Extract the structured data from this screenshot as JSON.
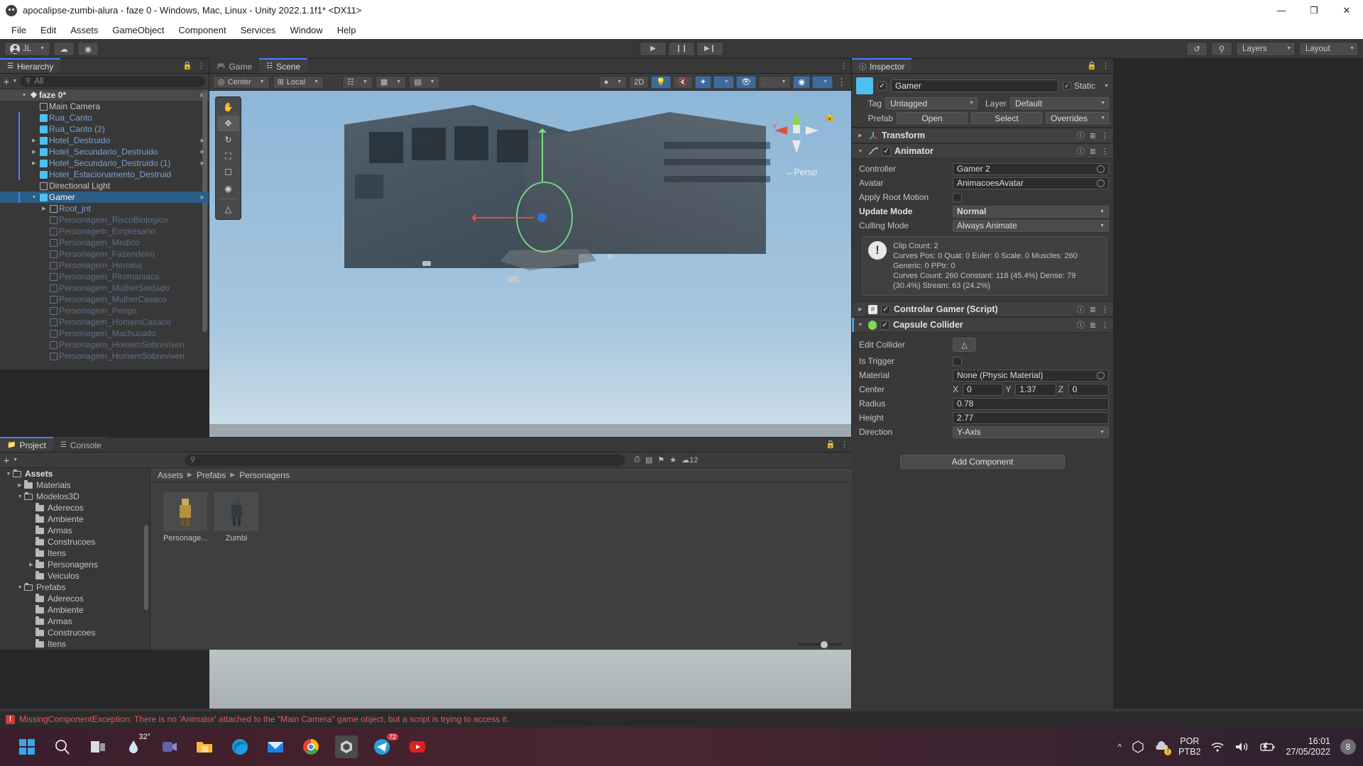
{
  "window": {
    "title": "apocalipse-zumbi-alura - faze 0 - Windows, Mac, Linux - Unity 2022.1.1f1* <DX11>",
    "minimize": "—",
    "maximize": "❐",
    "close": "✕"
  },
  "menubar": [
    "File",
    "Edit",
    "Assets",
    "GameObject",
    "Component",
    "Services",
    "Window",
    "Help"
  ],
  "toolbar": {
    "account": "JL",
    "play": "▶",
    "pause": "❙❙",
    "step": "▶❙",
    "layers": "Layers",
    "layout": "Layout"
  },
  "hierarchy": {
    "tab": "Hierarchy",
    "search_placeholder": "All",
    "scene": "faze 0*",
    "items": [
      {
        "label": "Main Camera",
        "depth": 2,
        "type": "go",
        "expand": "none"
      },
      {
        "label": "Rua_Canto",
        "depth": 2,
        "type": "prefab",
        "expand": "none"
      },
      {
        "label": "Rua_Canto (2)",
        "depth": 2,
        "type": "prefab",
        "expand": "none"
      },
      {
        "label": "Hotel_Destruido",
        "depth": 2,
        "type": "prefab",
        "expand": "collapsed",
        "arrow": true
      },
      {
        "label": "Hotel_Secundario_Destruido",
        "depth": 2,
        "type": "prefab",
        "expand": "collapsed",
        "arrow": true
      },
      {
        "label": "Hotel_Secundario_Destruido (1)",
        "depth": 2,
        "type": "prefab",
        "expand": "collapsed",
        "arrow": true
      },
      {
        "label": "Hotel_Estacionamento_Destruid",
        "depth": 2,
        "type": "prefab",
        "expand": "none"
      },
      {
        "label": "Directional Light",
        "depth": 2,
        "type": "go",
        "expand": "none"
      },
      {
        "label": "Gamer",
        "depth": 2,
        "type": "prefab",
        "expand": "expanded",
        "selected": true,
        "arrow": true
      },
      {
        "label": "Root_jnt",
        "depth": 3,
        "type": "go-blue",
        "expand": "collapsed"
      },
      {
        "label": "Personagem_RiscoBiologico",
        "depth": 3,
        "type": "dim",
        "expand": "none"
      },
      {
        "label": "Personagem_Empresario",
        "depth": 3,
        "type": "dim",
        "expand": "none"
      },
      {
        "label": "Personagem_Medico",
        "depth": 3,
        "type": "dim",
        "expand": "none"
      },
      {
        "label": "Personagem_Fazendeiro",
        "depth": 3,
        "type": "dim",
        "expand": "none"
      },
      {
        "label": "Personagem_Heroina",
        "depth": 3,
        "type": "dim",
        "expand": "none"
      },
      {
        "label": "Personagem_Piromaniaca",
        "depth": 3,
        "type": "dim",
        "expand": "none"
      },
      {
        "label": "Personagem_MulherSoldado",
        "depth": 3,
        "type": "dim",
        "expand": "none"
      },
      {
        "label": "Personagem_MulherCasaco",
        "depth": 3,
        "type": "dim",
        "expand": "none"
      },
      {
        "label": "Personagem_Perigo",
        "depth": 3,
        "type": "dim",
        "expand": "none"
      },
      {
        "label": "Personagem_HomemCasaco",
        "depth": 3,
        "type": "dim",
        "expand": "none"
      },
      {
        "label": "Personagem_Machucado",
        "depth": 3,
        "type": "dim",
        "expand": "none"
      },
      {
        "label": "Personagem_HomemSobreviven",
        "depth": 3,
        "type": "dim",
        "expand": "none"
      },
      {
        "label": "Personagem_HomemSobreviven",
        "depth": 3,
        "type": "dim",
        "expand": "none"
      }
    ]
  },
  "scene_view": {
    "tabs": [
      {
        "label": "Game",
        "icon": "gamepad-icon",
        "active": false
      },
      {
        "label": "Scene",
        "icon": "scene-icon",
        "active": true
      }
    ],
    "pivot": "Center",
    "space": "Local",
    "persp_label": "←Persp",
    "axis_x": "x",
    "axis_y": "y",
    "tools": [
      "hand-tool",
      "move-tool",
      "rotate-tool",
      "scale-tool",
      "rect-tool",
      "transform-tool",
      "custom-tool"
    ]
  },
  "project": {
    "tabs": [
      {
        "label": "Project",
        "active": true
      },
      {
        "label": "Console",
        "active": false
      }
    ],
    "search_placeholder": "",
    "asset_count": "12",
    "tree": [
      {
        "label": "Assets",
        "depth": 0,
        "expand": "expanded",
        "open": true,
        "bold": true
      },
      {
        "label": "Materiais",
        "depth": 1,
        "expand": "collapsed",
        "open": false
      },
      {
        "label": "Modelos3D",
        "depth": 1,
        "expand": "expanded",
        "open": true
      },
      {
        "label": "Aderecos",
        "depth": 2,
        "expand": "none",
        "open": false
      },
      {
        "label": "Ambiente",
        "depth": 2,
        "expand": "none",
        "open": false
      },
      {
        "label": "Armas",
        "depth": 2,
        "expand": "none",
        "open": false
      },
      {
        "label": "Construcoes",
        "depth": 2,
        "expand": "none",
        "open": false
      },
      {
        "label": "Itens",
        "depth": 2,
        "expand": "none",
        "open": false
      },
      {
        "label": "Personagens",
        "depth": 2,
        "expand": "collapsed",
        "open": false
      },
      {
        "label": "Veiculos",
        "depth": 2,
        "expand": "none",
        "open": false
      },
      {
        "label": "Prefabs",
        "depth": 1,
        "expand": "expanded",
        "open": true
      },
      {
        "label": "Aderecos",
        "depth": 2,
        "expand": "none",
        "open": false
      },
      {
        "label": "Ambiente",
        "depth": 2,
        "expand": "none",
        "open": false
      },
      {
        "label": "Armas",
        "depth": 2,
        "expand": "none",
        "open": false
      },
      {
        "label": "Construcoes",
        "depth": 2,
        "expand": "none",
        "open": false
      },
      {
        "label": "Itens",
        "depth": 2,
        "expand": "none",
        "open": false
      }
    ],
    "breadcrumb": [
      "Assets",
      "Prefabs",
      "Personagens"
    ],
    "assets": [
      {
        "label": "Personage...",
        "kind": "prefab-yellow"
      },
      {
        "label": "Zumbi",
        "kind": "prefab-dark"
      }
    ]
  },
  "inspector": {
    "tab": "Inspector",
    "object_name": "Gamer",
    "static_label": "Static",
    "tag_label": "Tag",
    "tag_value": "Untagged",
    "layer_label": "Layer",
    "layer_value": "Default",
    "prefab_label": "Prefab",
    "prefab_open": "Open",
    "prefab_select": "Select",
    "prefab_overrides": "Overrides",
    "components": [
      {
        "name": "Transform",
        "expanded": false,
        "enabled": null,
        "icon": "transform-icon"
      },
      {
        "name": "Animator",
        "expanded": true,
        "enabled": true,
        "icon": "animator-icon"
      },
      {
        "name": "Controlar Gamer (Script)",
        "expanded": false,
        "enabled": true,
        "icon": "script-icon"
      },
      {
        "name": "Capsule Collider",
        "expanded": true,
        "enabled": true,
        "icon": "collider-icon"
      }
    ],
    "animator": {
      "controller_label": "Controller",
      "controller_value": "Gamer 2",
      "avatar_label": "Avatar",
      "avatar_value": "AnimacoesAvatar",
      "apply_root_label": "Apply Root Motion",
      "apply_root_checked": false,
      "update_mode_label": "Update Mode",
      "update_mode_value": "Normal",
      "culling_mode_label": "Culling Mode",
      "culling_mode_value": "Always Animate",
      "info": [
        "Clip Count: 2",
        "Curves Pos: 0 Quat: 0 Euler: 0 Scale: 0 Muscles: 260",
        "Generic: 0 PPtr: 0",
        "Curves Count: 260 Constant: 118 (45.4%) Dense: 79",
        "(30.4%) Stream: 63 (24.2%)"
      ]
    },
    "capsule": {
      "edit_label": "Edit Collider",
      "is_trigger_label": "Is Trigger",
      "is_trigger_checked": false,
      "material_label": "Material",
      "material_value": "None (Physic Material)",
      "center_label": "Center",
      "center_x_label": "X",
      "center_x": "0",
      "center_y_label": "Y",
      "center_y": "1.37",
      "center_z_label": "Z",
      "center_z": "0",
      "radius_label": "Radius",
      "radius": "0.78",
      "height_label": "Height",
      "height": "2.77",
      "direction_label": "Direction",
      "direction": "Y-Axis"
    },
    "add_component": "Add Component"
  },
  "statusbar": {
    "message": "MissingComponentException: There is no 'Animator' attached to the \"Main Camera\" game object, but a script is trying to access it."
  },
  "taskbar": {
    "weather": "32°",
    "language_line1": "POR",
    "language_line2": "PTB2",
    "time": "16:01",
    "date": "27/05/2022",
    "notification_count": "8"
  },
  "colors": {
    "accent": "#4c7eff",
    "selection": "#2c5d87",
    "prefab_blue": "#7aa2d0",
    "error_red": "#e05b5b",
    "unity_cyan": "#4ec0f0"
  }
}
